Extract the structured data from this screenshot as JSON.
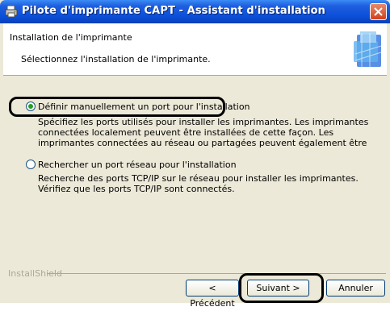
{
  "window": {
    "title": "Pilote d'imprimante CAPT - Assistant d'installation"
  },
  "header": {
    "title": "Installation de l'imprimante",
    "subtitle": "Sélectionnez l'installation de l'imprimante."
  },
  "options": [
    {
      "label": "Définir manuellement un port pour l'installation",
      "selected": true,
      "description": "Spécifiez les ports utilisés pour installer les imprimantes. Les imprimantes connectées localement peuvent être installées de cette façon. Les imprimantes connectées au réseau ou partagées peuvent également être installées."
    },
    {
      "label": "Rechercher un port réseau pour l'installation",
      "selected": false,
      "description": "Recherche des ports TCP/IP sur le réseau pour installer les imprimantes. Vérifiez que les ports TCP/IP sont connectés."
    }
  ],
  "footer": {
    "brand": "InstallShield",
    "back": "< Précédent",
    "next": "Suivant >",
    "cancel": "Annuler"
  },
  "colors": {
    "title_bar": "#0b4fd8",
    "window_bg": "#ece9d8",
    "close_button": "#d2411c",
    "radio_dot": "#21a121"
  },
  "icons": [
    "printer-app-icon",
    "close-icon",
    "wizard-header-art"
  ]
}
